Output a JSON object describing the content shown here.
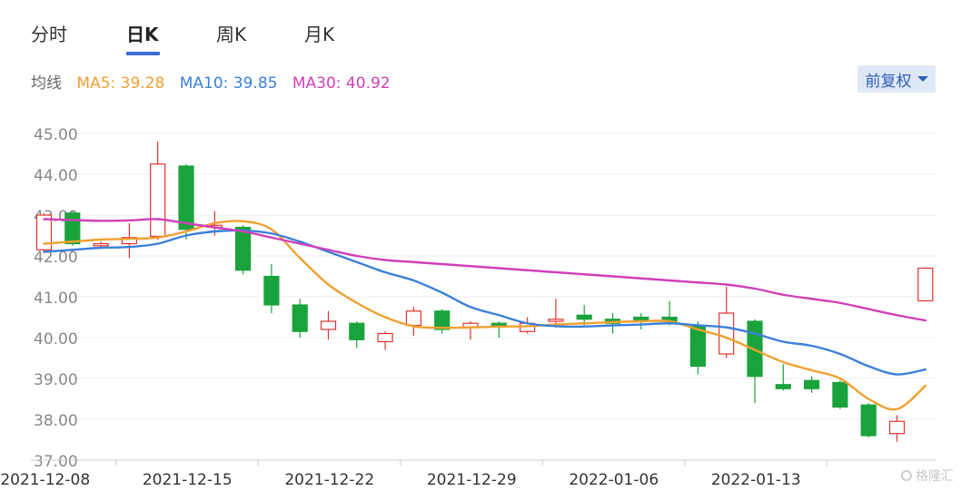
{
  "tabs": [
    {
      "label": "分时",
      "active": false
    },
    {
      "label": "日K",
      "active": true
    },
    {
      "label": "周K",
      "active": false
    },
    {
      "label": "月K",
      "active": false
    }
  ],
  "ma_legend": {
    "label": "均线",
    "items": [
      {
        "text": "MA5: 39.28",
        "color": "#f0a030"
      },
      {
        "text": "MA10: 39.85",
        "color": "#3c80d8"
      },
      {
        "text": "MA30: 40.92",
        "color": "#d040b8"
      }
    ]
  },
  "adjust_button": {
    "label": "前复权"
  },
  "watermark": "格隆汇",
  "colors": {
    "up": "#e0332f",
    "down": "#1aa33c",
    "grid": "#eeeeee",
    "axis_text": "#888888"
  },
  "chart_data": {
    "type": "candlestick",
    "ylim": [
      37.0,
      45.0
    ],
    "yticks": [
      "45.00",
      "44.00",
      "43.00",
      "42.00",
      "41.00",
      "40.00",
      "39.00",
      "38.00",
      "37.00"
    ],
    "xtick_labels": [
      {
        "label": "2021-12-08",
        "index": 2.5
      },
      {
        "label": "2021-12-15",
        "index": 7.5
      },
      {
        "label": "2021-12-22",
        "index": 12.5
      },
      {
        "label": "2021-12-29",
        "index": 17.5
      },
      {
        "label": "2022-01-06",
        "index": 22.5
      },
      {
        "label": "2022-01-13",
        "index": 27.5
      }
    ],
    "candles": [
      {
        "o": 42.15,
        "c": 43.0,
        "h": 43.05,
        "l": 42.1
      },
      {
        "o": 43.05,
        "c": 42.3,
        "h": 43.1,
        "l": 42.25
      },
      {
        "o": 42.25,
        "c": 42.3,
        "h": 42.35,
        "l": 42.2
      },
      {
        "o": 42.3,
        "c": 42.45,
        "h": 42.8,
        "l": 41.95
      },
      {
        "o": 42.48,
        "c": 44.25,
        "h": 44.8,
        "l": 42.4
      },
      {
        "o": 44.2,
        "c": 42.65,
        "h": 44.25,
        "l": 42.4
      },
      {
        "o": 42.7,
        "c": 42.75,
        "h": 43.1,
        "l": 42.5
      },
      {
        "o": 42.7,
        "c": 41.65,
        "h": 42.75,
        "l": 41.55
      },
      {
        "o": 41.5,
        "c": 40.8,
        "h": 41.8,
        "l": 40.6
      },
      {
        "o": 40.8,
        "c": 40.15,
        "h": 40.95,
        "l": 40.0
      },
      {
        "o": 40.2,
        "c": 40.4,
        "h": 40.65,
        "l": 39.95
      },
      {
        "o": 40.35,
        "c": 39.95,
        "h": 40.4,
        "l": 39.75
      },
      {
        "o": 39.9,
        "c": 40.1,
        "h": 40.15,
        "l": 39.7
      },
      {
        "o": 40.3,
        "c": 40.65,
        "h": 40.75,
        "l": 40.05
      },
      {
        "o": 40.65,
        "c": 40.2,
        "h": 40.7,
        "l": 40.1
      },
      {
        "o": 40.25,
        "c": 40.35,
        "h": 40.4,
        "l": 39.95
      },
      {
        "o": 40.35,
        "c": 40.3,
        "h": 40.4,
        "l": 40.0
      },
      {
        "o": 40.15,
        "c": 40.35,
        "h": 40.5,
        "l": 40.1
      },
      {
        "o": 40.4,
        "c": 40.45,
        "h": 40.95,
        "l": 40.25
      },
      {
        "o": 40.55,
        "c": 40.45,
        "h": 40.8,
        "l": 40.3
      },
      {
        "o": 40.45,
        "c": 40.35,
        "h": 40.6,
        "l": 40.1
      },
      {
        "o": 40.5,
        "c": 40.4,
        "h": 40.6,
        "l": 40.2
      },
      {
        "o": 40.5,
        "c": 40.4,
        "h": 40.9,
        "l": 40.3
      },
      {
        "o": 40.3,
        "c": 39.3,
        "h": 40.4,
        "l": 39.1
      },
      {
        "o": 39.6,
        "c": 40.6,
        "h": 41.25,
        "l": 39.5
      },
      {
        "o": 40.4,
        "c": 39.05,
        "h": 40.45,
        "l": 38.4
      },
      {
        "o": 38.85,
        "c": 38.75,
        "h": 39.35,
        "l": 38.7
      },
      {
        "o": 38.95,
        "c": 38.75,
        "h": 39.05,
        "l": 38.65
      },
      {
        "o": 38.9,
        "c": 38.3,
        "h": 38.95,
        "l": 38.25
      },
      {
        "o": 38.35,
        "c": 37.6,
        "h": 38.4,
        "l": 37.55
      },
      {
        "o": 37.65,
        "c": 37.95,
        "h": 38.1,
        "l": 37.45
      },
      {
        "o": 40.9,
        "c": 41.7,
        "h": 41.7,
        "l": 40.9
      }
    ],
    "series": [
      {
        "values": [
          42.3,
          42.35,
          42.4,
          42.42,
          42.45,
          42.6,
          42.8,
          42.85,
          42.65,
          41.95,
          41.3,
          40.85,
          40.5,
          40.28,
          40.24,
          40.25,
          40.27,
          40.28,
          40.32,
          40.35,
          40.38,
          40.4,
          40.4,
          40.2,
          40.0,
          39.7,
          39.4,
          39.2,
          39.0,
          38.5,
          38.25,
          38.82
        ]
      },
      {
        "values": [
          42.1,
          42.15,
          42.2,
          42.22,
          42.3,
          42.5,
          42.6,
          42.62,
          42.55,
          42.35,
          42.1,
          41.85,
          41.6,
          41.4,
          41.1,
          40.75,
          40.55,
          40.35,
          40.28,
          40.27,
          40.3,
          40.32,
          40.35,
          40.3,
          40.25,
          40.1,
          39.9,
          39.8,
          39.6,
          39.3,
          39.1,
          39.22
        ]
      },
      {
        "values": [
          42.9,
          42.88,
          42.86,
          42.87,
          42.9,
          42.8,
          42.7,
          42.6,
          42.45,
          42.3,
          42.15,
          42.0,
          41.9,
          41.85,
          41.8,
          41.75,
          41.7,
          41.65,
          41.6,
          41.55,
          41.5,
          41.45,
          41.4,
          41.35,
          41.3,
          41.2,
          41.05,
          40.95,
          40.85,
          40.7,
          40.55,
          40.42
        ]
      }
    ]
  }
}
